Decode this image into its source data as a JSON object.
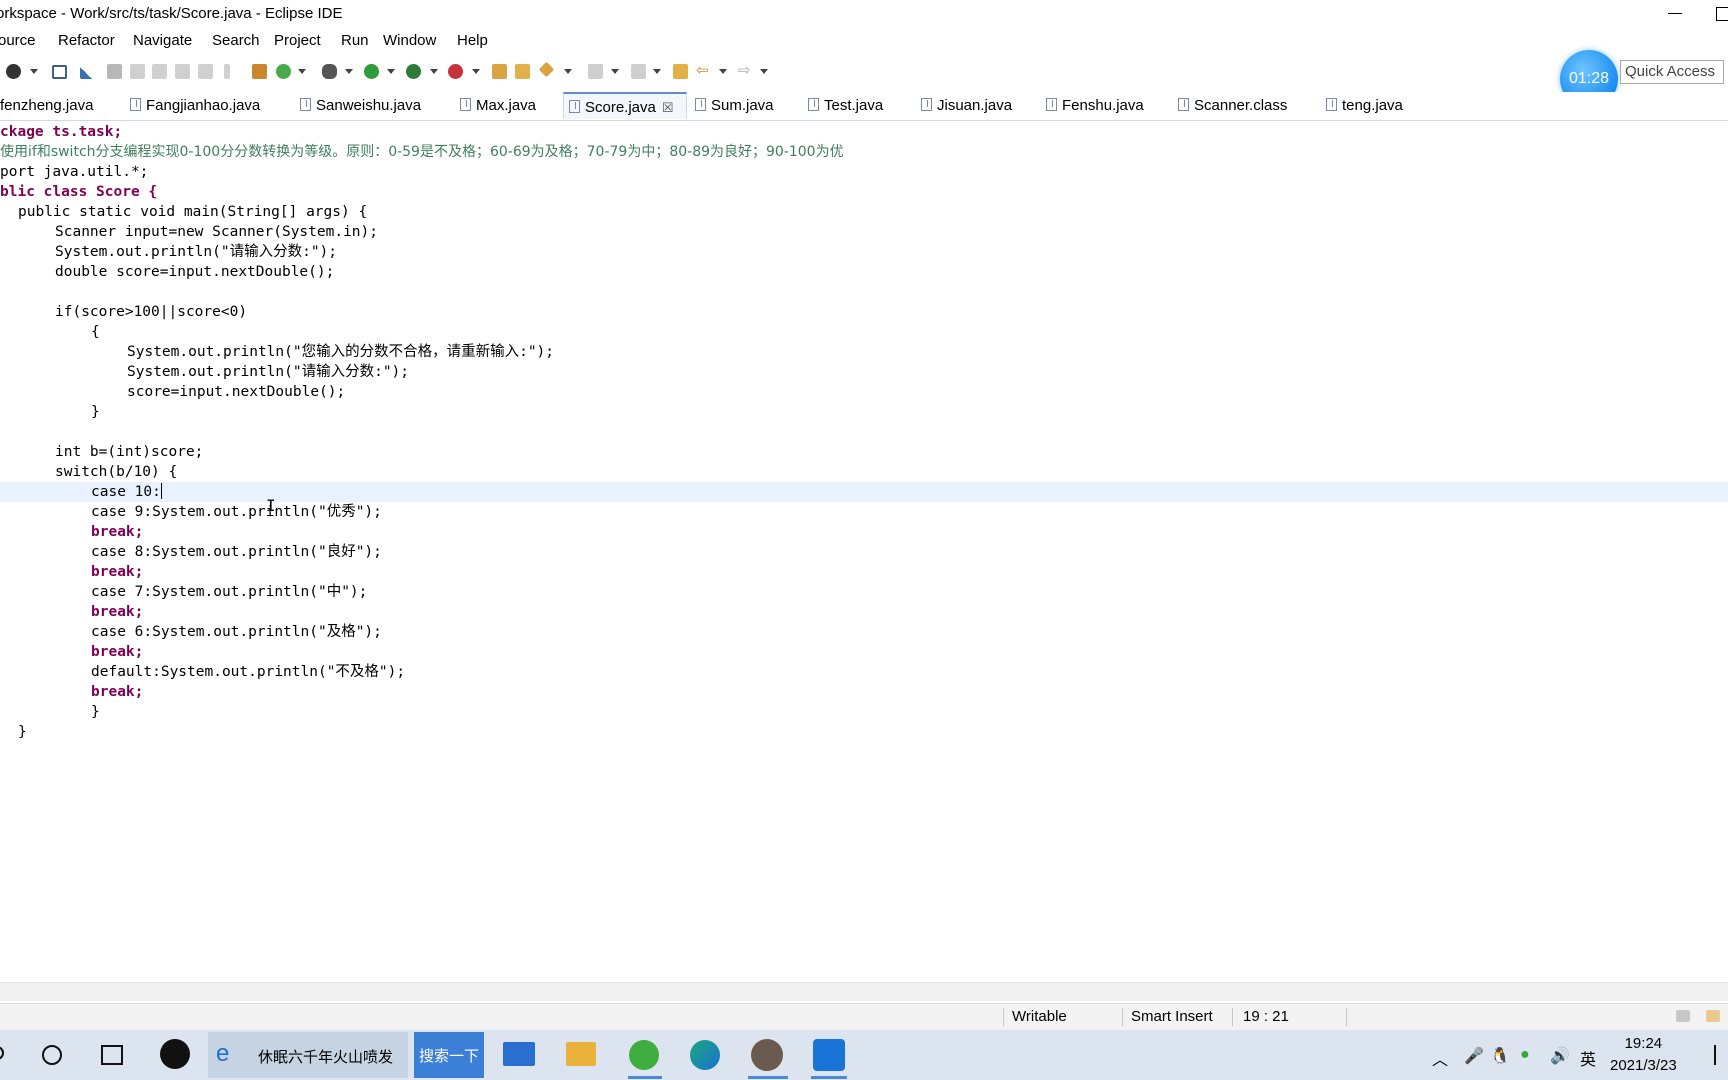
{
  "window": {
    "title": "orkspace - Work/src/ts/task/Score.java - Eclipse IDE"
  },
  "menu": [
    "ource",
    "Refactor",
    "Navigate",
    "Search",
    "Project",
    "Run",
    "Window",
    "Help"
  ],
  "timer": "01:28",
  "quick_access": "Quick Access",
  "tabs": [
    {
      "label": "fenzheng.java",
      "active": false
    },
    {
      "label": "Fangjianhao.java",
      "active": false
    },
    {
      "label": "Sanweishu.java",
      "active": false
    },
    {
      "label": "Max.java",
      "active": false
    },
    {
      "label": "Score.java",
      "active": true,
      "close": "☒"
    },
    {
      "label": "Sum.java",
      "active": false
    },
    {
      "label": "Test.java",
      "active": false
    },
    {
      "label": "Jisuan.java",
      "active": false
    },
    {
      "label": "Fenshu.java",
      "active": false
    },
    {
      "label": "Scanner.class",
      "active": false
    },
    {
      "label": "teng.java",
      "active": false
    }
  ],
  "code": {
    "l01": "ckage ts.task;",
    "l02": "使用if和switch分支编程实现0-100分分数转换为等级。原则：0-59是不及格；60-69为及格；70-79为中；80-89为良好；90-100为优",
    "l03": "port java.util.*;",
    "l04": "blic class Score {",
    "l05": "public static void main(String[] args) {",
    "l06": "Scanner input=new Scanner(System.in);",
    "l07": "System.out.println(\"请输入分数:\");",
    "l08": "double score=input.nextDouble();",
    "l10": "if(score>100||score<0)",
    "l11": "{",
    "l12": "System.out.println(\"您输入的分数不合格，请重新输入:\");",
    "l13": "System.out.println(\"请输入分数:\");",
    "l14": "score=input.nextDouble();",
    "l15": "}",
    "l17": "int b=(int)score;",
    "l18": "switch(b/10) {",
    "l19": "case 10:",
    "l20": "case 9:System.out.println(\"优秀\");",
    "l21": "break;",
    "l22": "case 8:System.out.println(\"良好\");",
    "l23": "break;",
    "l24": "case 7:System.out.println(\"中\");",
    "l25": "break;",
    "l26": "case 6:System.out.println(\"及格\");",
    "l27": "break;",
    "l28": "default:System.out.println(\"不及格\");",
    "l29": "break;",
    "l30": "}",
    "l31": "}"
  },
  "status": {
    "writable": "Writable",
    "insert_mode": "Smart Insert",
    "position": "19 : 21"
  },
  "taskbar": {
    "search_label": "休眠六千年火山喷发",
    "search_button": "搜索一下",
    "ime": "英",
    "time": "19:24",
    "date": "2021/3/23"
  },
  "colors": {
    "keyword": "#7f0055",
    "string": "#2a00ff",
    "comment": "#3f7f5f",
    "field": "#0000c0",
    "accent": "#1a8df0"
  }
}
